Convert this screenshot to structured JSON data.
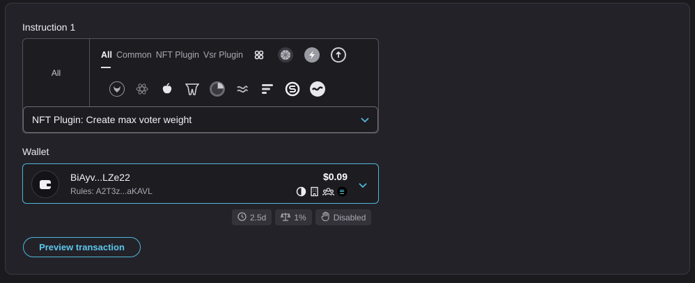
{
  "instruction": {
    "label": "Instruction 1",
    "all_cell": "All",
    "filters": [
      {
        "label": "All",
        "active": true
      },
      {
        "label": "Common",
        "active": false
      },
      {
        "label": "NFT Plugin",
        "active": false
      },
      {
        "label": "Vsr Plugin",
        "active": false
      }
    ],
    "program_icons_row1": [
      "mango-x-icon",
      "sphere-icon",
      "lightning-icon",
      "circle-arrow-icon"
    ],
    "program_icons_row2": [
      "bull-icon",
      "atom-icon",
      "apple-leaf-icon",
      "m-shield-icon",
      "pie-icon",
      "wave-s-icon",
      "stripes-icon",
      "s-ring-icon",
      "wave-circle-icon"
    ],
    "selected": "NFT Plugin: Create max voter weight"
  },
  "wallet": {
    "label": "Wallet",
    "name": "BiAyv...LZe22",
    "rules": "Rules: A2T3z...aKAVL",
    "amount": "$0.09",
    "status_icons": [
      "contrast-icon",
      "building-icon",
      "group-icon",
      "solana-icon"
    ]
  },
  "chips": [
    {
      "icon": "clock-icon",
      "label": "2.5d"
    },
    {
      "icon": "scale-icon",
      "label": "1%"
    },
    {
      "icon": "hand-icon",
      "label": "Disabled"
    }
  ],
  "preview_button": "Preview transaction",
  "colors": {
    "accent": "#4fb8d9",
    "background": "#232229"
  }
}
